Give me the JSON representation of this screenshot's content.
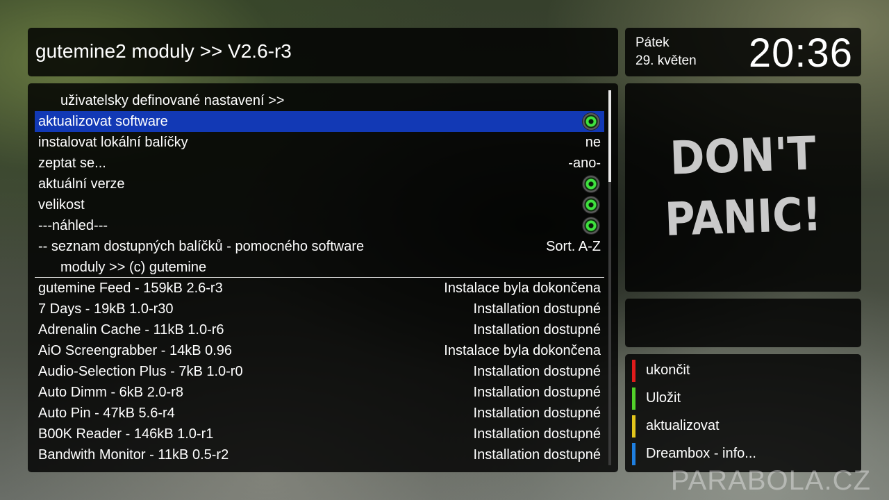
{
  "header": {
    "title": "gutemine2 moduly >> V2.6-r3"
  },
  "clock": {
    "day": "Pátek",
    "date": "29. květen",
    "time": "20:36"
  },
  "settings": [
    {
      "label": "uživatelsky definované nastavení >>",
      "value": ""
    },
    {
      "label": "aktualizovat software",
      "value": ""
    },
    {
      "label": "instalovat lokální balíčky",
      "value": "ne"
    },
    {
      "label": "zeptat se...",
      "value": "-ano-"
    },
    {
      "label": "aktuální verze",
      "value": ""
    },
    {
      "label": "velikost",
      "value": ""
    },
    {
      "label": "---náhled---",
      "value": ""
    },
    {
      "label": "-- seznam dostupných balíčků - pomocného software",
      "value": "Sort. A-Z"
    },
    {
      "label": "moduly >> (c) gutemine",
      "value": ""
    }
  ],
  "packages": [
    {
      "name": "gutemine Feed - 159kB 2.6-r3",
      "status": "Instalace byla dokončena"
    },
    {
      "name": "7 Days - 19kB 1.0-r30",
      "status": "Installation dostupné"
    },
    {
      "name": "Adrenalin Cache - 11kB 1.0-r6",
      "status": "Installation dostupné"
    },
    {
      "name": "AiO Screengrabber - 14kB 0.96",
      "status": "Instalace byla dokončena"
    },
    {
      "name": "Audio-Selection Plus - 7kB 1.0-r0",
      "status": "Installation dostupné"
    },
    {
      "name": "Auto Dimm - 6kB 2.0-r8",
      "status": "Installation dostupné"
    },
    {
      "name": "Auto Pin - 47kB 5.6-r4",
      "status": "Installation dostupné"
    },
    {
      "name": "B00K Reader - 146kB 1.0-r1",
      "status": "Installation dostupné"
    },
    {
      "name": "Bandwith Monitor - 11kB 0.5-r2",
      "status": "Installation dostupné"
    }
  ],
  "preview": {
    "image_text": "DON'T PANIC!",
    "text_color": "#c9c9c9"
  },
  "keys": [
    {
      "label": "ukončit",
      "color": "#e01b1b"
    },
    {
      "label": "Uložit",
      "color": "#52d12a"
    },
    {
      "label": "aktualizovat",
      "color": "#e3c51c"
    },
    {
      "label": "Dreambox - info...",
      "color": "#1f7fe0"
    }
  ],
  "watermark": "PARABOLA.CZ",
  "colors": {
    "selection": "#1239b5",
    "toggle_on": "#3fe33f"
  }
}
